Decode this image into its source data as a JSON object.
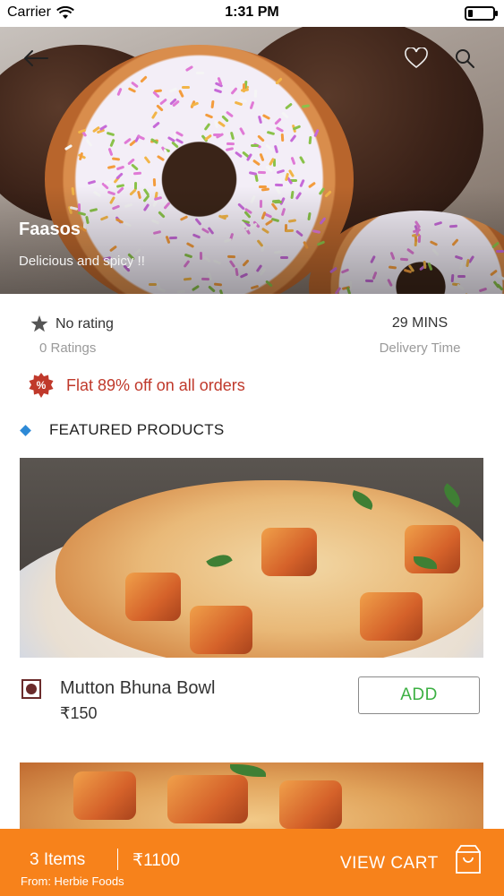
{
  "status_bar": {
    "carrier": "Carrier",
    "time": "1:31 PM",
    "battery_level": 0.18
  },
  "hero": {
    "title": "Faasos",
    "subtitle": "Delicious and spicy !!",
    "icons": [
      "back-arrow-icon",
      "heart-icon",
      "search-icon"
    ]
  },
  "info": {
    "rating_text": "No rating",
    "ratings_count": "0 Ratings",
    "delivery_value": "29 MINS",
    "delivery_label": "Delivery Time"
  },
  "offer": {
    "badge": "%",
    "text": "Flat 89% off on all orders",
    "color": "#c0392b"
  },
  "featured": {
    "heading": "FEATURED PRODUCTS",
    "accent": "#2d89d6"
  },
  "products": [
    {
      "name": "Mutton Bhuna Bowl",
      "price": "₹150",
      "add_label": "ADD"
    }
  ],
  "cart": {
    "items": "3 Items",
    "total": "₹1100",
    "from": "From: Herbie Foods",
    "view_label": "VIEW CART",
    "color": "#f7821b"
  }
}
